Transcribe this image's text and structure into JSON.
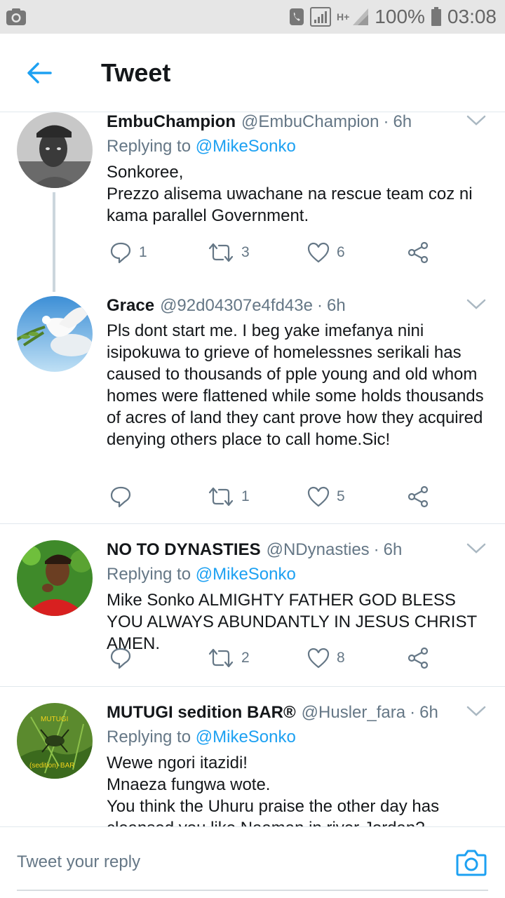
{
  "status_bar": {
    "battery": "100%",
    "time": "03:08",
    "network": "H+",
    "icons": [
      "camera-icon",
      "phone-icon",
      "signal-icon",
      "battery-icon"
    ]
  },
  "header": {
    "title": "Tweet",
    "back_icon": "arrow-left-icon"
  },
  "colors": {
    "accent": "#1da1f2",
    "secondary_text": "#657786",
    "divider": "#e1e8ed"
  },
  "tweets": [
    {
      "name": "EmbuChampion",
      "handle": "@EmbuChampion",
      "time": "6h",
      "replying_prefix": "Replying to",
      "replying_to": "@MikeSonko",
      "text": "Sonkoree,\nPrezzo alisema uwachane na rescue team coz ni kama parallel Government.",
      "replies": "1",
      "retweets": "3",
      "likes": "6"
    },
    {
      "name": "Grace",
      "handle": "@92d04307e4fd43e",
      "time": "6h",
      "text": "Pls dont start me. I beg yake imefanya nini isipokuwa to grieve of homelessnes serikali  has caused to thousands of pple young and old whom homes were flattened while some  holds thousands of acres of land they cant prove how they acquired denying others place to call home.Sic!",
      "replies": "",
      "retweets": "1",
      "likes": "5"
    },
    {
      "name": "NO TO DYNASTIES",
      "handle": "@NDynasties",
      "time": "6h",
      "replying_prefix": "Replying to",
      "replying_to": "@MikeSonko",
      "text": "Mike Sonko ALMIGHTY FATHER GOD BLESS YOU ALWAYS ABUNDANTLY IN JESUS CHRIST AMEN.",
      "replies": "",
      "retweets": "2",
      "likes": "8"
    },
    {
      "name": "MUTUGI sedition BAR®",
      "handle": "@Husler_fara",
      "time": "6h",
      "replying_prefix": "Replying to",
      "replying_to": "@MikeSonko",
      "text": "Wewe ngori itazidi!\nMnaeza fungwa wote.\nYou think the Uhuru praise the other day has cleansed you like Naaman in river Jordan?",
      "avatar_text_top": "MUTUGI",
      "avatar_text_bottom": "(sedition) BAR"
    }
  ],
  "reply_bar": {
    "placeholder": "Tweet your reply",
    "camera_icon": "camera-icon"
  }
}
